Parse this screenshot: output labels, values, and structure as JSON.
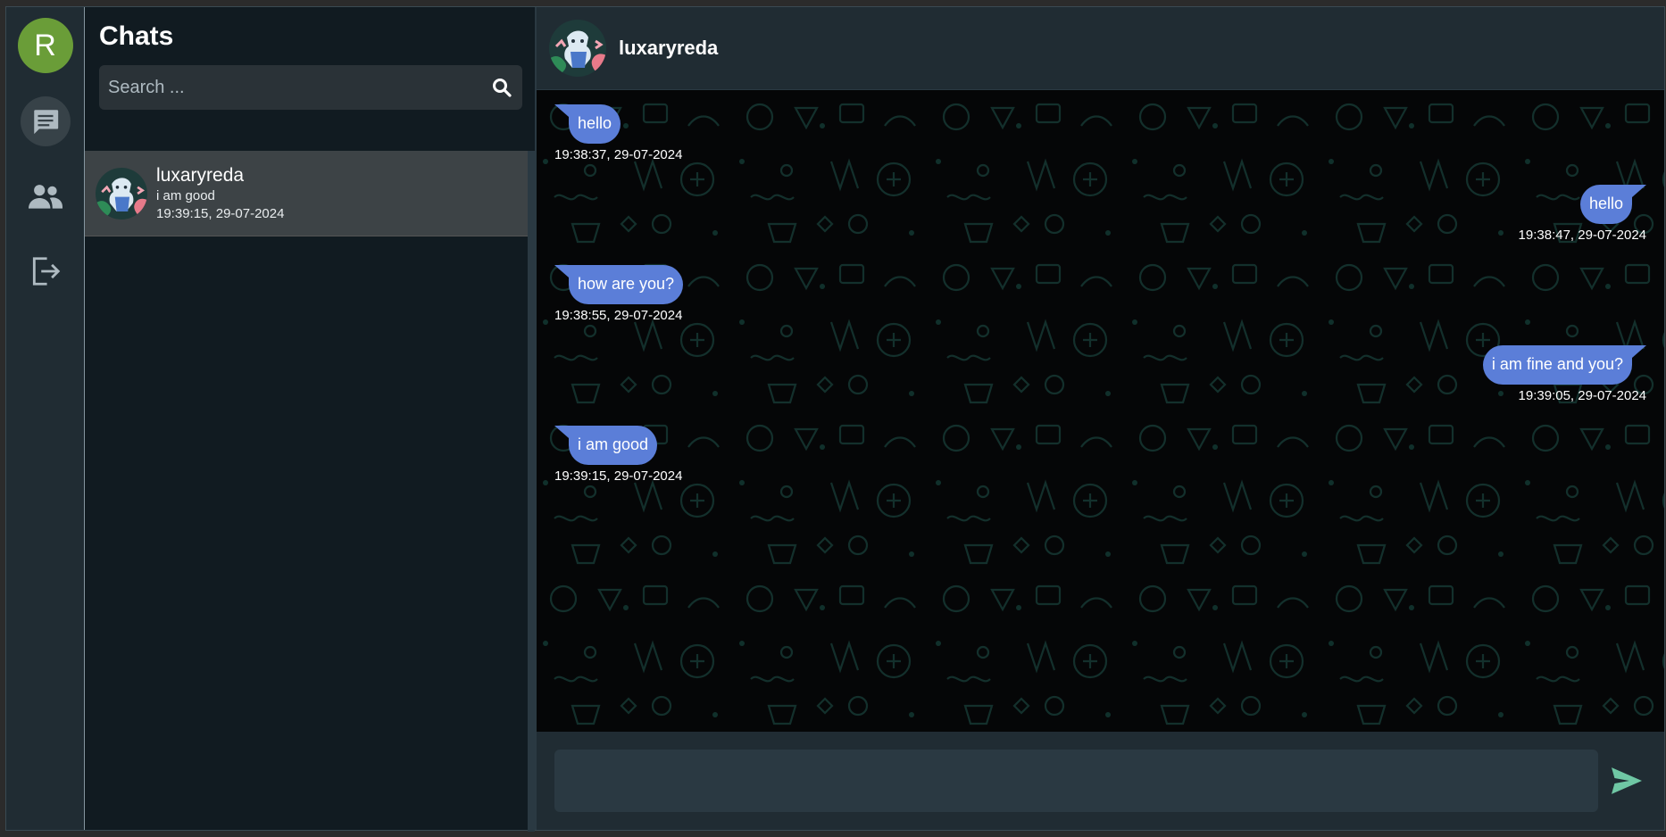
{
  "rail": {
    "avatar_letter": "R",
    "items": [
      {
        "name": "chats",
        "icon": "chat-icon",
        "active": true
      },
      {
        "name": "contacts",
        "icon": "users-icon",
        "active": false
      },
      {
        "name": "logout",
        "icon": "logout-icon",
        "active": false
      }
    ]
  },
  "sidebar": {
    "title": "Chats",
    "search": {
      "placeholder": "Search ...",
      "value": ""
    },
    "chats": [
      {
        "name": "luxaryreda",
        "last_message": "i am good",
        "time": "19:39:15, 29-07-2024"
      }
    ]
  },
  "conversation": {
    "contact_name": "luxaryreda",
    "messages": [
      {
        "side": "left",
        "text": "hello",
        "time": "19:38:37, 29-07-2024"
      },
      {
        "side": "right",
        "text": "hello",
        "time": "19:38:47, 29-07-2024"
      },
      {
        "side": "left",
        "text": "how are you?",
        "time": "19:38:55, 29-07-2024"
      },
      {
        "side": "right",
        "text": "i am fine and you?",
        "time": "19:39:05, 29-07-2024"
      },
      {
        "side": "left",
        "text": "i am good",
        "time": "19:39:15, 29-07-2024"
      }
    ],
    "composer": {
      "value": "",
      "placeholder": ""
    }
  },
  "colors": {
    "bubble": "#5b7ed8",
    "rail_avatar": "#6a9d38",
    "send_icon": "#6fc7a4"
  }
}
